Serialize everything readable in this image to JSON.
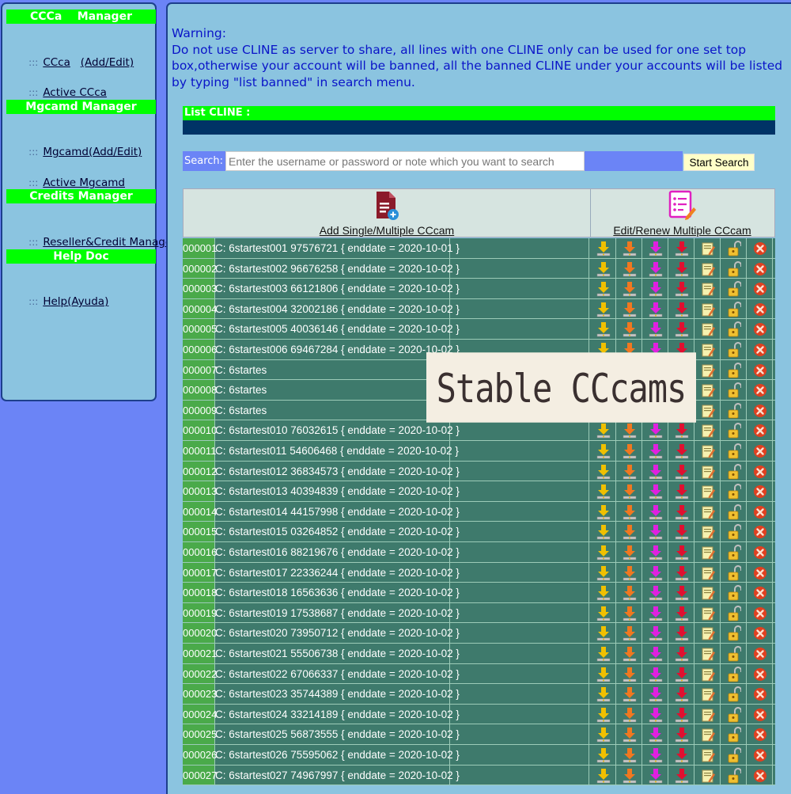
{
  "sidebar": {
    "sections": [
      {
        "title": "CCCa    Manager",
        "items": [
          {
            "label": "CCca",
            "extra": "(Add/Edit)"
          },
          {
            "label": "Active CCca"
          }
        ]
      },
      {
        "title": "Mgcamd Manager",
        "items": [
          {
            "label": "Mgcamd(Add/Edit)"
          },
          {
            "label": "Active Mgcamd"
          }
        ]
      },
      {
        "title": "Credits Manager",
        "items": [
          {
            "label": "Reseller&Credit Manager"
          }
        ]
      },
      {
        "title": "Help Doc",
        "items": [
          {
            "label": "Help(Ayuda)"
          }
        ]
      }
    ],
    "bullet": ":::"
  },
  "warning": {
    "heading": "Warning:",
    "text": "Do not use CLINE as server to share, all lines with one CLINE only can be used for one set top box,otherwise your account will be banned, all the banned CLINE under your accounts will be listed by typing \"list banned\" in search menu."
  },
  "list_title": "List CLINE :",
  "search": {
    "label": "Search:",
    "placeholder": "Enter the username or password or note which you want to search",
    "button": "Start Search"
  },
  "table_header": {
    "add": "Add Single/Multiple CCcam",
    "edit": "Edit/Renew Multiple CCcam"
  },
  "rows": [
    {
      "num": "000001",
      "desc": "C: 6startest001 97576721 { enddate = 2020-10-01 }"
    },
    {
      "num": "000002",
      "desc": "C: 6startest002 96676258 { enddate = 2020-10-02 }"
    },
    {
      "num": "000003",
      "desc": "C: 6startest003 66121806 { enddate = 2020-10-02 }"
    },
    {
      "num": "000004",
      "desc": "C: 6startest004 32002186 { enddate = 2020-10-02 }"
    },
    {
      "num": "000005",
      "desc": "C: 6startest005 40036146 { enddate = 2020-10-02 }"
    },
    {
      "num": "000006",
      "desc": "C: 6startest006 69467284 { enddate = 2020-10-02 }"
    },
    {
      "num": "000007",
      "desc": "C: 6startes"
    },
    {
      "num": "000008",
      "desc": "C: 6startes"
    },
    {
      "num": "000009",
      "desc": "C: 6startes"
    },
    {
      "num": "000010",
      "desc": "C: 6startest010 76032615 { enddate = 2020-10-02 }"
    },
    {
      "num": "000011",
      "desc": "C: 6startest011 54606468 { enddate = 2020-10-02 }"
    },
    {
      "num": "000012",
      "desc": "C: 6startest012 36834573 { enddate = 2020-10-02 }"
    },
    {
      "num": "000013",
      "desc": "C: 6startest013 40394839 { enddate = 2020-10-02 }"
    },
    {
      "num": "000014",
      "desc": "C: 6startest014 44157998 { enddate = 2020-10-02 }"
    },
    {
      "num": "000015",
      "desc": "C: 6startest015 03264852 { enddate = 2020-10-02 }"
    },
    {
      "num": "000016",
      "desc": "C: 6startest016 88219676 { enddate = 2020-10-02 }"
    },
    {
      "num": "000017",
      "desc": "C: 6startest017 22336244 { enddate = 2020-10-02 }"
    },
    {
      "num": "000018",
      "desc": "C: 6startest018 16563636 { enddate = 2020-10-02 }"
    },
    {
      "num": "000019",
      "desc": "C: 6startest019 17538687 { enddate = 2020-10-02 }"
    },
    {
      "num": "000020",
      "desc": "C: 6startest020 73950712 { enddate = 2020-10-02 }"
    },
    {
      "num": "000021",
      "desc": "C: 6startest021 55506738 { enddate = 2020-10-02 }"
    },
    {
      "num": "000022",
      "desc": "C: 6startest022 67066337 { enddate = 2020-10-02 }"
    },
    {
      "num": "000023",
      "desc": "C: 6startest023 35744389 { enddate = 2020-10-02 }"
    },
    {
      "num": "000024",
      "desc": "C: 6startest024 33214189 { enddate = 2020-10-02 }"
    },
    {
      "num": "000025",
      "desc": "C: 6startest025 56873555 { enddate = 2020-10-02 }"
    },
    {
      "num": "000026",
      "desc": "C: 6startest026 75595062 { enddate = 2020-10-02 }"
    },
    {
      "num": "000027",
      "desc": "C: 6startest027 74967997 { enddate = 2020-10-02 }"
    }
  ],
  "row_actions": [
    {
      "icon": "download-yellow-icon",
      "color": "#f0c000"
    },
    {
      "icon": "download-orange-icon",
      "color": "#f07820"
    },
    {
      "icon": "download-magenta-icon",
      "color": "#e020e0"
    },
    {
      "icon": "download-red-icon",
      "color": "#e01030"
    },
    {
      "icon": "edit-note-icon",
      "color": "#f4f0a0"
    },
    {
      "icon": "unlock-icon",
      "color": "#f0c030"
    },
    {
      "icon": "delete-icon",
      "color": "#e04020"
    }
  ],
  "overlay_text": "Stable CCcams",
  "colors": {
    "page_bg": "#6b84f6",
    "panel_bg": "#8bc4e0",
    "green_header": "#00ff00",
    "row_bg": "#3e7a6c",
    "num_bg": "#4aaa4a"
  }
}
